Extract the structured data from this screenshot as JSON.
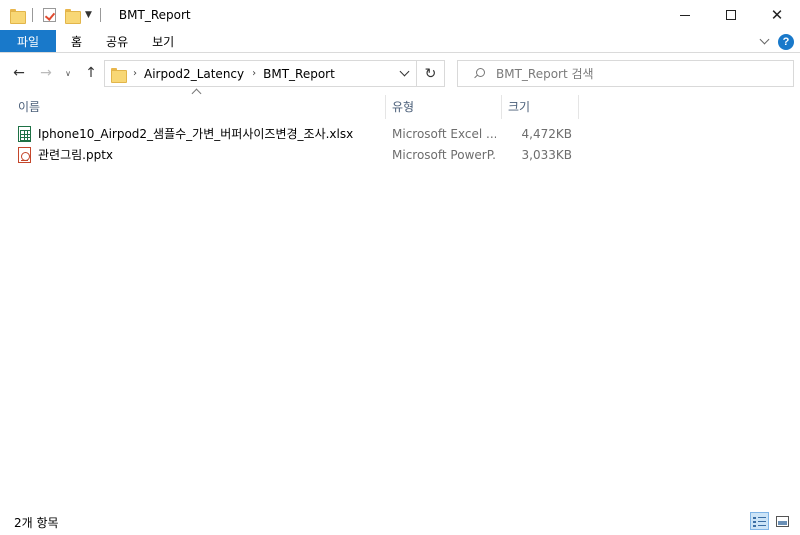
{
  "window": {
    "title": "BMT_Report",
    "buttons": {
      "minimize": "minimize",
      "maximize": "maximize",
      "close": "✕"
    }
  },
  "quick_access": [
    "folder-icon",
    "properties-icon",
    "new-folder-icon",
    "customize-dropdown"
  ],
  "ribbon": {
    "tabs": [
      {
        "label": "파일",
        "active": true
      },
      {
        "label": "홈"
      },
      {
        "label": "공유"
      },
      {
        "label": "보기"
      }
    ],
    "accent": "#1979ca"
  },
  "navigation": {
    "breadcrumb": [
      "Airpod2_Latency",
      "BMT_Report"
    ],
    "search_placeholder": "BMT_Report 검색"
  },
  "columns": {
    "name": "이름",
    "type": "유형",
    "size": "크기",
    "sort": "name-ascending"
  },
  "files": [
    {
      "name": "Iphone10_Airpod2_샘플수_가변_버퍼사이즈변경_조사.xlsx",
      "type": "Microsoft Excel ...",
      "size": "4,472KB",
      "icon": "excel-file-icon"
    },
    {
      "name": "관련그림.pptx",
      "type": "Microsoft PowerP...",
      "size": "3,033KB",
      "icon": "powerpoint-file-icon"
    }
  ],
  "status": {
    "item_count": "2개 항목",
    "view": "details"
  }
}
